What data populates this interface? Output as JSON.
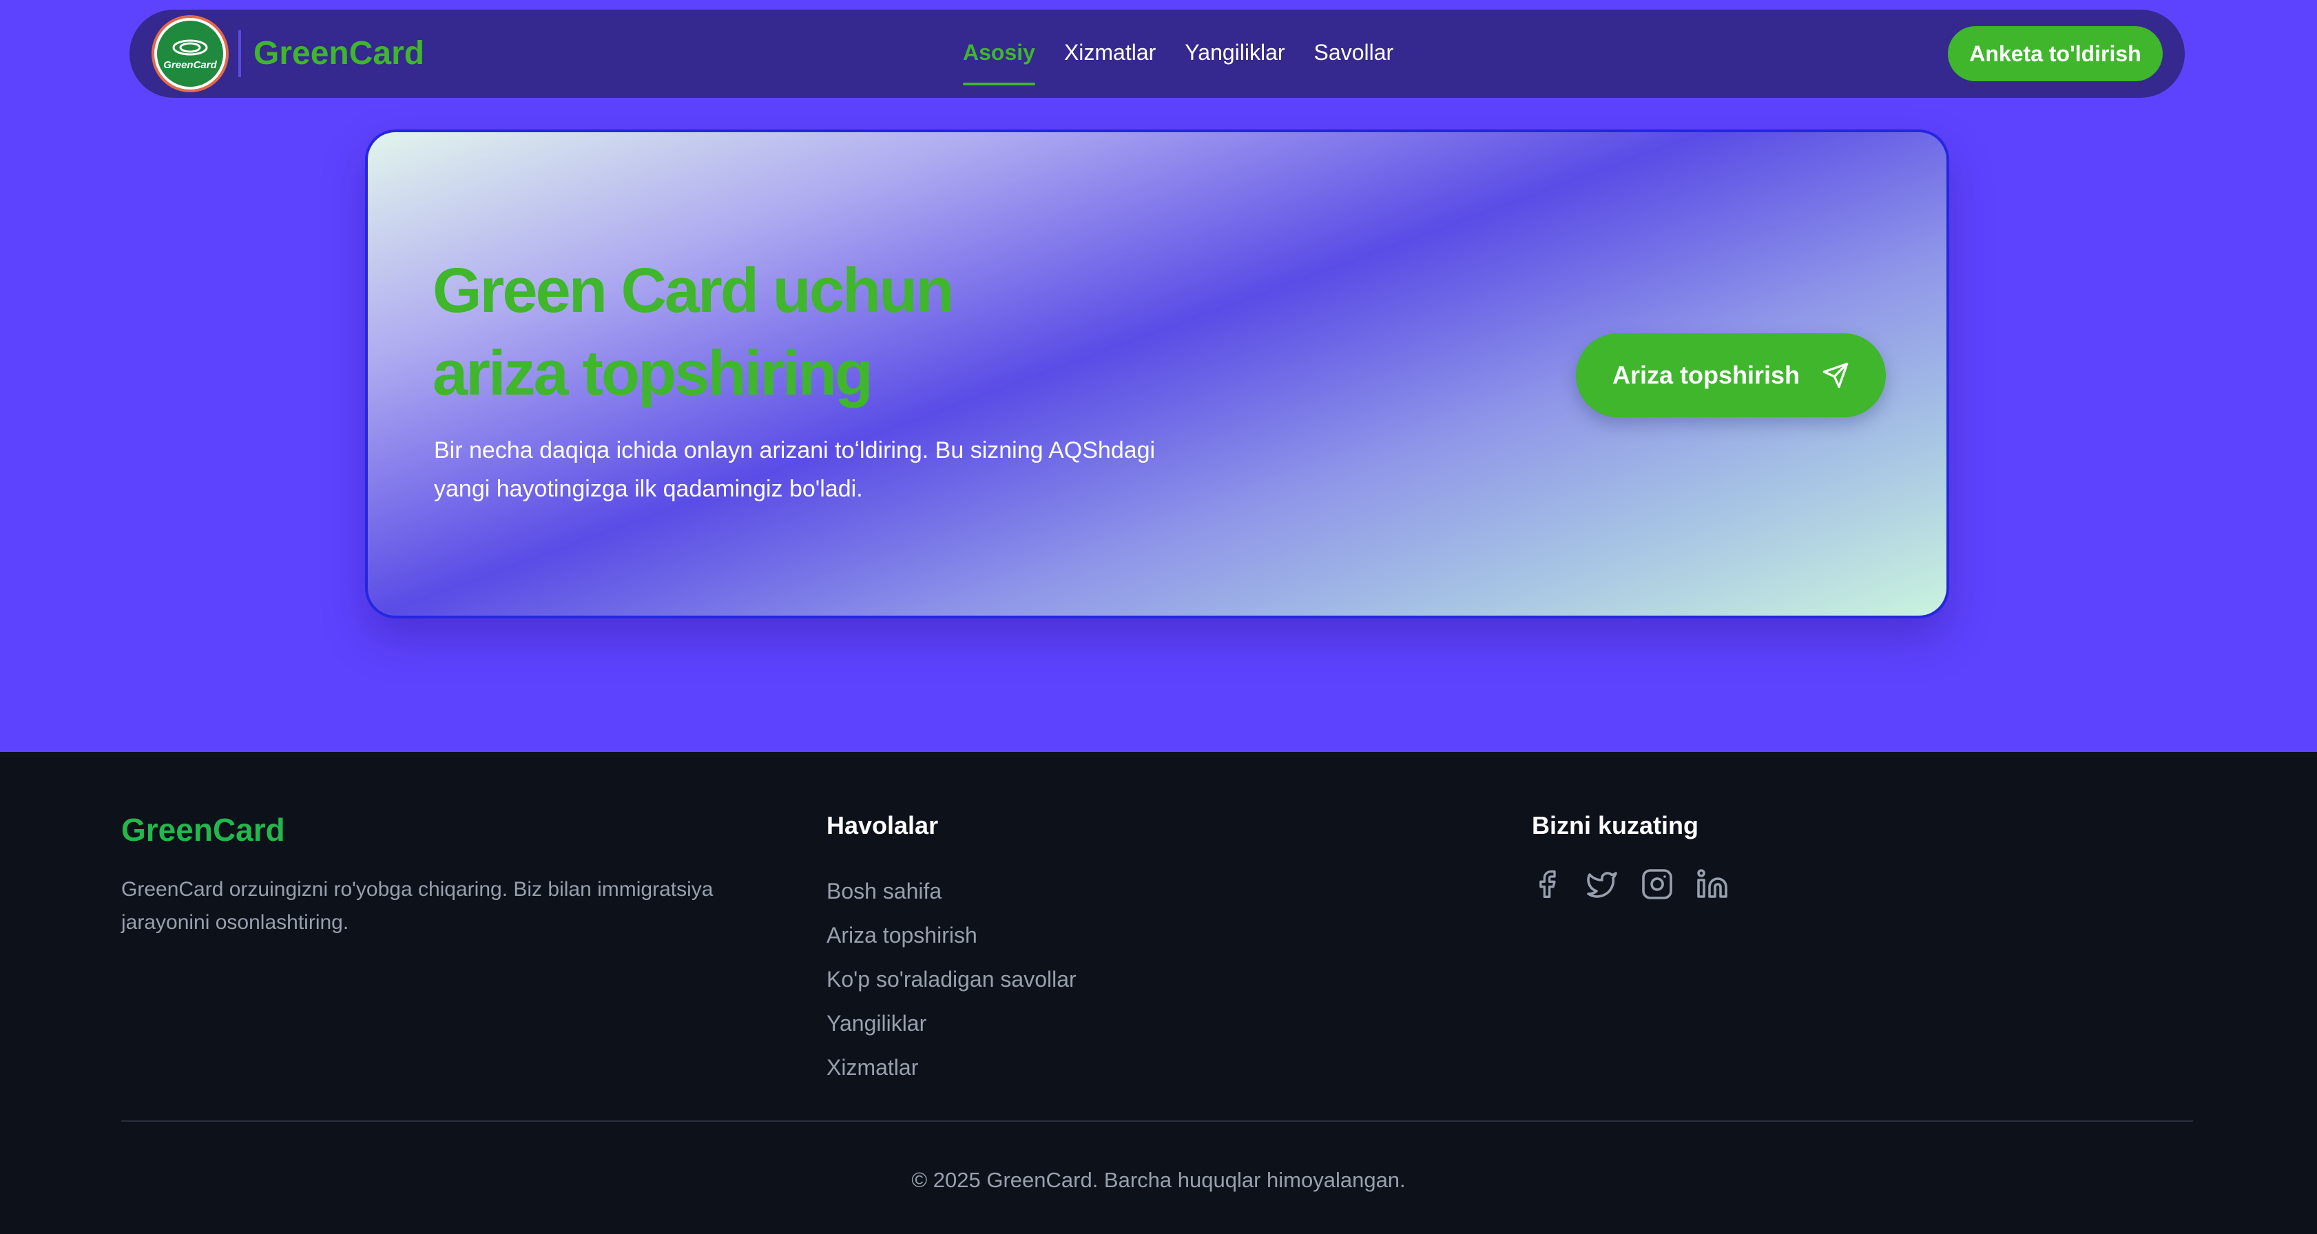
{
  "navbar": {
    "logo_text": "GreenCard",
    "brand": "GreenCard",
    "links": [
      "Asosiy",
      "Xizmatlar",
      "Yangiliklar",
      "Savollar"
    ],
    "active_link": "Asosiy",
    "cta_label": "Anketa to'ldirish"
  },
  "hero": {
    "title_line1": "Green Card uchun",
    "title_line2": "ariza topshiring",
    "subtitle_line1": "Bir necha daqiqa ichida onlayn arizani toʻldiring. Bu sizning AQShdagi",
    "subtitle_line2": "yangi hayotingizga ilk qadamingiz bo'ladi.",
    "cta_label": "Ariza topshirish",
    "cta_icon": "send-icon"
  },
  "footer": {
    "brand": "GreenCard",
    "description_line1": "GreenCard orzuingizni ro'yobga chiqaring. Biz bilan immigratsiya",
    "description_line2": "jarayonini osonlashtiring.",
    "links_title": "Havolalar",
    "links": [
      "Bosh sahifa",
      "Ariza topshirish",
      "Ko'p so'raladigan savollar",
      "Yangiliklar",
      "Xizmatlar"
    ],
    "social_title": "Bizni kuzating",
    "social_icons": [
      "facebook-icon",
      "twitter-icon",
      "instagram-icon",
      "linkedin-icon"
    ],
    "copyright": "© 2025 GreenCard. Barcha huquqlar himoyalangan."
  },
  "colors": {
    "hero_background": "#5e43fe",
    "navbar_background": "#35288e",
    "accent_green": "#3fb62c",
    "footer_background": "#0d111a",
    "footer_text": "#98a0ad"
  }
}
